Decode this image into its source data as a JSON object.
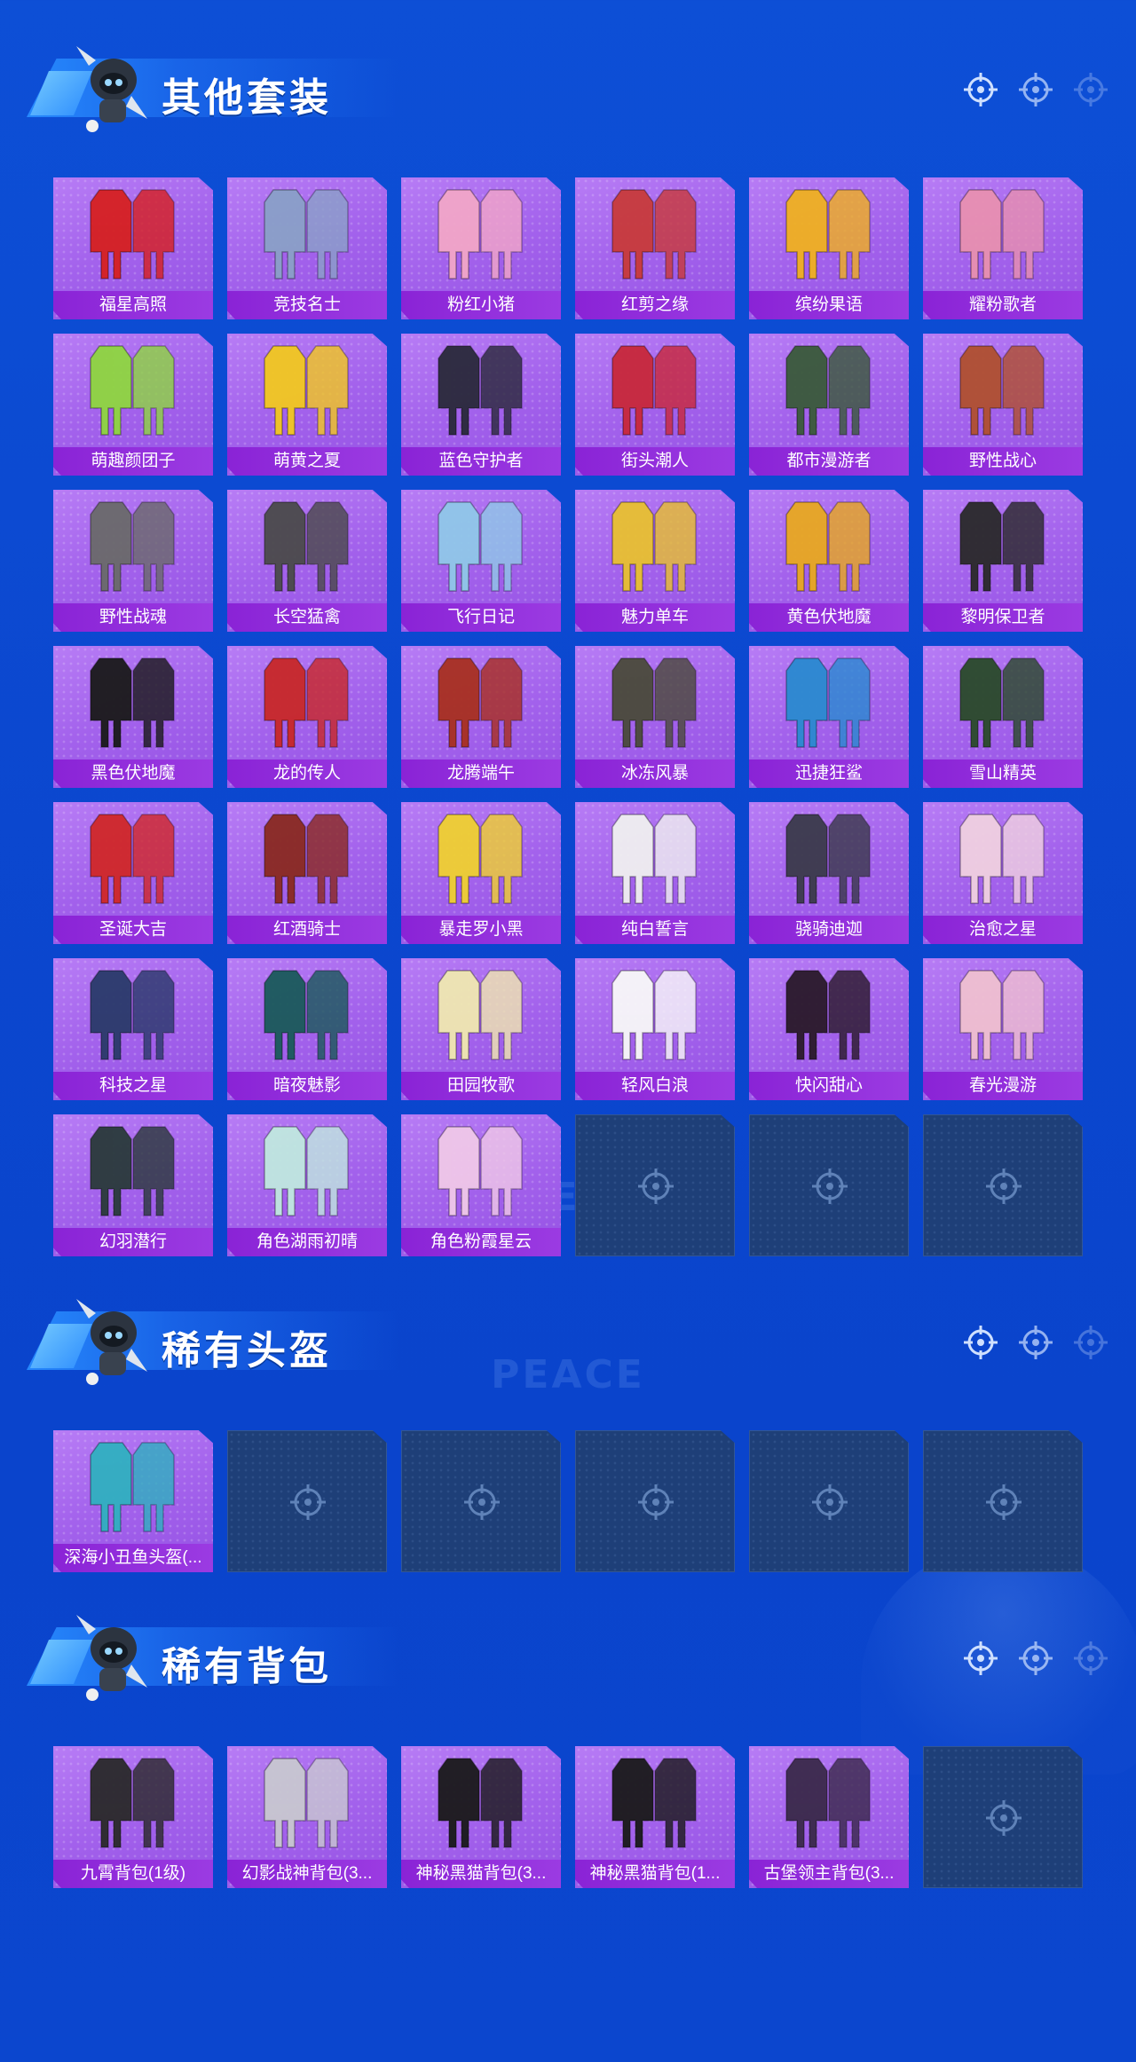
{
  "sections": [
    {
      "title": "其他套装",
      "items": [
        {
          "name": "福星高照",
          "hue": "#d62020"
        },
        {
          "name": "竞技名士",
          "hue": "#8aa0c8"
        },
        {
          "name": "粉红小猪",
          "hue": "#f2a6c8"
        },
        {
          "name": "红剪之缘",
          "hue": "#c83a3a"
        },
        {
          "name": "缤纷果语",
          "hue": "#f0b020"
        },
        {
          "name": "耀粉歌者",
          "hue": "#e890b0"
        },
        {
          "name": "萌趣颜团子",
          "hue": "#8fd640"
        },
        {
          "name": "萌黄之夏",
          "hue": "#f2c820"
        },
        {
          "name": "蓝色守护者",
          "hue": "#2a2a3a"
        },
        {
          "name": "街头潮人",
          "hue": "#c8283a"
        },
        {
          "name": "都市漫游者",
          "hue": "#3a5a3a"
        },
        {
          "name": "野性战心",
          "hue": "#b05030"
        },
        {
          "name": "野性战魂",
          "hue": "#6a6a6a"
        },
        {
          "name": "长空猛禽",
          "hue": "#4a4a4a"
        },
        {
          "name": "飞行日记",
          "hue": "#90c8e8"
        },
        {
          "name": "魅力单车",
          "hue": "#e8c030"
        },
        {
          "name": "黄色伏地魔",
          "hue": "#e8a820"
        },
        {
          "name": "黎明保卫者",
          "hue": "#2a2a2a"
        },
        {
          "name": "黑色伏地魔",
          "hue": "#1a1a1a"
        },
        {
          "name": "龙的传人",
          "hue": "#c82828"
        },
        {
          "name": "龙腾端午",
          "hue": "#a83020"
        },
        {
          "name": "冰冻风暴",
          "hue": "#4a4a3a"
        },
        {
          "name": "迅捷狂鲨",
          "hue": "#2a8ad0"
        },
        {
          "name": "雪山精英",
          "hue": "#2a4a2a"
        },
        {
          "name": "圣诞大吉",
          "hue": "#d02828"
        },
        {
          "name": "红酒骑士",
          "hue": "#8a2a20"
        },
        {
          "name": "暴走罗小黑",
          "hue": "#f0d030"
        },
        {
          "name": "纯白誓言",
          "hue": "#f0f0f0"
        },
        {
          "name": "骁骑迪迦",
          "hue": "#3a3a4a"
        },
        {
          "name": "治愈之星",
          "hue": "#f0d0e0"
        },
        {
          "name": "科技之星",
          "hue": "#2a3a6a"
        },
        {
          "name": "暗夜魅影",
          "hue": "#1a5a5a"
        },
        {
          "name": "田园牧歌",
          "hue": "#f0e8b0"
        },
        {
          "name": "轻风白浪",
          "hue": "#f8f8f8"
        },
        {
          "name": "快闪甜心",
          "hue": "#2a1a2a"
        },
        {
          "name": "春光漫游",
          "hue": "#f0c0d0"
        },
        {
          "name": "幻羽潜行",
          "hue": "#2a3a3a"
        },
        {
          "name": "角色湖雨初晴",
          "hue": "#c0e8e0"
        },
        {
          "name": "角色粉霞星云",
          "hue": "#f0c8e8"
        }
      ],
      "empty_slots": 3
    },
    {
      "title": "稀有头盔",
      "items": [
        {
          "name": "深海小丑鱼头盔(...",
          "hue": "#30b0c0"
        }
      ],
      "empty_slots": 5
    },
    {
      "title": "稀有背包",
      "items": [
        {
          "name": "九霄背包(1级)",
          "hue": "#2a2a2a"
        },
        {
          "name": "幻影战神背包(3...",
          "hue": "#c8c8d0"
        },
        {
          "name": "神秘黑猫背包(3...",
          "hue": "#1a1a1a"
        },
        {
          "name": "神秘黑猫背包(1...",
          "hue": "#1a1a1a"
        },
        {
          "name": "古堡领主背包(3...",
          "hue": "#3a2a4a"
        }
      ],
      "empty_slots": 1
    }
  ],
  "watermark": "GAME FOR PEACE",
  "colors": {
    "background": "#0b47cf",
    "card_purple": "#a362ec",
    "label_purple": "#8a23d6",
    "empty_slot": "#1e3f78"
  }
}
